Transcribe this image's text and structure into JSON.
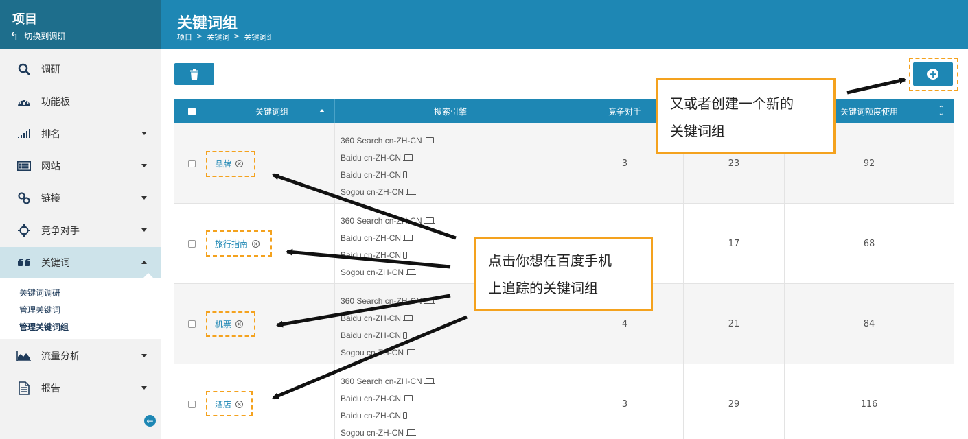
{
  "sidebar": {
    "title": "项目",
    "switch_label": "切换到调研",
    "items": [
      {
        "label": "调研",
        "icon": "search-icon",
        "caret": false,
        "active": false
      },
      {
        "label": "功能板",
        "icon": "dashboard-icon",
        "caret": false,
        "active": false
      },
      {
        "label": "排名",
        "icon": "signal-icon",
        "caret": true,
        "active": false
      },
      {
        "label": "网站",
        "icon": "list-icon",
        "caret": true,
        "active": false
      },
      {
        "label": "链接",
        "icon": "link-icon",
        "caret": true,
        "active": false
      },
      {
        "label": "竞争对手",
        "icon": "crosshair-icon",
        "caret": true,
        "active": false
      },
      {
        "label": "关键词",
        "icon": "quote-icon",
        "caret": true,
        "active": true
      },
      {
        "label": "流量分析",
        "icon": "area-chart-icon",
        "caret": true,
        "active": false
      },
      {
        "label": "报告",
        "icon": "document-icon",
        "caret": true,
        "active": false
      }
    ],
    "subitems": [
      "关键词调研",
      "管理关键词",
      "管理关键词组"
    ],
    "current_subitem": "管理关键词组"
  },
  "header": {
    "title": "关键词组",
    "breadcrumb": [
      "项目",
      ">",
      "关键词",
      ">",
      "关键词组"
    ]
  },
  "table": {
    "columns": [
      "关键词组",
      "搜索引擎",
      "竞争对手",
      "",
      "关键词额度使用"
    ],
    "rows": [
      {
        "group": "品牌",
        "engines": [
          {
            "name": "360 Search cn-ZH-CN",
            "device": "laptop-icon"
          },
          {
            "name": "Baidu cn-ZH-CN",
            "device": "laptop-icon"
          },
          {
            "name": "Baidu cn-ZH-CN",
            "device": "phone-icon"
          },
          {
            "name": "Sogou cn-ZH-CN",
            "device": "laptop-icon"
          }
        ],
        "competitors": "3",
        "keywords": "23",
        "quota": "92"
      },
      {
        "group": "旅行指南",
        "engines": [
          {
            "name": "360 Search cn-ZH-CN",
            "device": "laptop-icon"
          },
          {
            "name": "Baidu cn-ZH-CN",
            "device": "laptop-icon"
          },
          {
            "name": "Baidu cn-ZH-CN",
            "device": "phone-icon"
          },
          {
            "name": "Sogou cn-ZH-CN",
            "device": "laptop-icon"
          }
        ],
        "competitors": "",
        "keywords": "17",
        "quota": "68"
      },
      {
        "group": "机票",
        "engines": [
          {
            "name": "360 Search cn-ZH-CN",
            "device": "laptop-icon"
          },
          {
            "name": "Baidu cn-ZH-CN",
            "device": "laptop-icon"
          },
          {
            "name": "Baidu cn-ZH-CN",
            "device": "phone-icon"
          },
          {
            "name": "Sogou cn-ZH-CN",
            "device": "laptop-icon"
          }
        ],
        "competitors": "4",
        "keywords": "21",
        "quota": "84"
      },
      {
        "group": "酒店",
        "engines": [
          {
            "name": "360 Search cn-ZH-CN",
            "device": "laptop-icon"
          },
          {
            "name": "Baidu cn-ZH-CN",
            "device": "laptop-icon"
          },
          {
            "name": "Baidu cn-ZH-CN",
            "device": "phone-icon"
          },
          {
            "name": "Sogou cn-ZH-CN",
            "device": "laptop-icon"
          }
        ],
        "competitors": "3",
        "keywords": "29",
        "quota": "116"
      }
    ]
  },
  "callouts": {
    "create": [
      "又或者创建一个新的",
      "关键词组"
    ],
    "click": [
      "点击你想在百度手机",
      "上追踪的关键词组"
    ]
  },
  "colors": {
    "header": "#1e87b4",
    "sidebar_head": "#1e6e8c",
    "accent": "#f4a21e"
  }
}
